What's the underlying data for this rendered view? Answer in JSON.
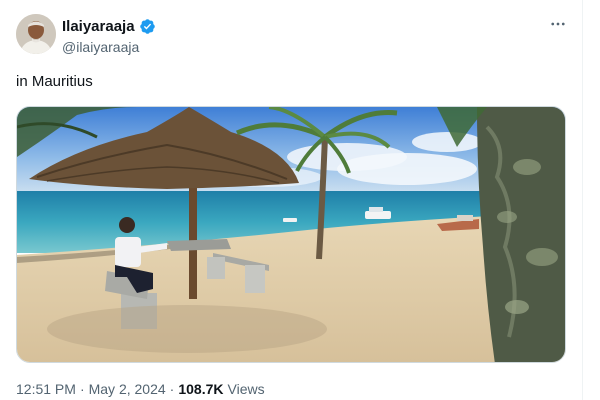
{
  "author": {
    "display_name": "Ilaiyaraaja",
    "handle": "@ilaiyaraaja",
    "verified": true,
    "verified_icon": "verified-badge-icon",
    "avatar_icon": "profile-photo"
  },
  "post": {
    "text": "in Mauritius",
    "media_alt": "Man seated under a thatched beach umbrella on a sandy beach in Mauritius with palm trees and a turquoise sea",
    "more_icon": "more-horizontal-icon"
  },
  "meta": {
    "time": "12:51 PM",
    "separator": "·",
    "date": "May 2, 2024",
    "views_count": "108.7K",
    "views_label": "Views"
  },
  "colors": {
    "verified_blue": "#1d9bf0",
    "secondary_text": "#536471",
    "primary_text": "#0f1419",
    "border": "#cfd9de"
  }
}
